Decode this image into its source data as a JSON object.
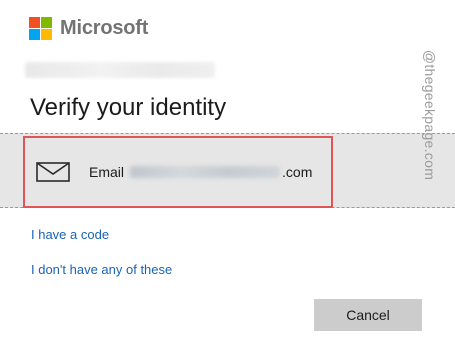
{
  "brand": {
    "name": "Microsoft",
    "logo_colors": [
      "#f25022",
      "#7fba00",
      "#00a4ef",
      "#ffb900"
    ]
  },
  "page": {
    "title": "Verify your identity"
  },
  "option": {
    "icon": "mail-icon",
    "label_prefix": "Email",
    "email_domain_suffix": ".com",
    "highlight_color": "#e05555"
  },
  "links": {
    "have_code": "I have a code",
    "dont_have": "I don't have any of these"
  },
  "buttons": {
    "cancel": "Cancel"
  },
  "watermark": "@thegeekpage.com"
}
